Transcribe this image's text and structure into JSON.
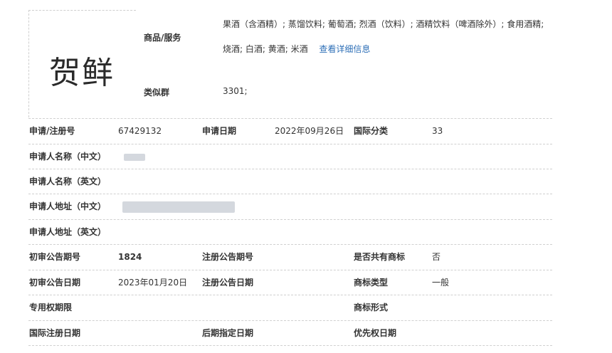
{
  "logo": {
    "text": "贺鲜"
  },
  "top": {
    "goods_label": "商品/服务",
    "goods_value_line1": "果酒（含酒精）; 蒸馏饮料; 葡萄酒; 烈酒（饮料）; 酒精饮料（啤酒除外）; 食用酒精;",
    "goods_value_line2": "烧酒; 白酒; 黄酒; 米酒",
    "details_link": "查看详细信息",
    "similar_label": "类似群",
    "similar_value": "3301;"
  },
  "rows": {
    "reg_no_label": "申请/注册号",
    "reg_no_value": "67429132",
    "app_date_label": "申请日期",
    "app_date_value": "2022年09月26日",
    "intl_class_label": "国际分类",
    "intl_class_value": "33",
    "applicant_cn_label": "申请人名称（中文）",
    "applicant_en_label": "申请人名称（英文）",
    "address_cn_label": "申请人地址（中文）",
    "address_en_label": "申请人地址（英文）",
    "prelim_issue_label": "初审公告期号",
    "prelim_issue_value": "1824",
    "reg_issue_label": "注册公告期号",
    "shared_label": "是否共有商标",
    "shared_value": "否",
    "prelim_date_label": "初审公告日期",
    "prelim_date_value": "2023年01月20日",
    "reg_date_label": "注册公告日期",
    "mark_type_label": "商标类型",
    "mark_type_value": "一般",
    "exclusive_label": "专用权期限",
    "mark_form_label": "商标形式",
    "intl_reg_date_label": "国际注册日期",
    "later_designation_label": "后期指定日期",
    "priority_date_label": "优先权日期"
  }
}
